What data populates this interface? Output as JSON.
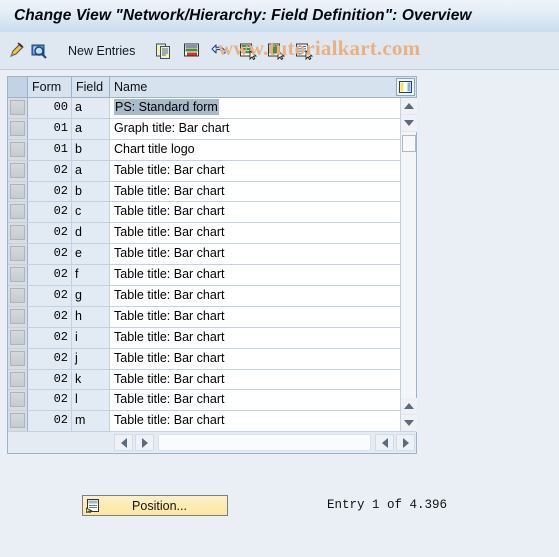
{
  "window": {
    "title": "Change View \"Network/Hierarchy: Field Definition\": Overview"
  },
  "watermark": {
    "text": "www.tutorialkart.com",
    "color": "#e8b183"
  },
  "toolbar": {
    "new_entries_label": "New Entries",
    "icons": [
      {
        "name": "change-pencil-icon",
        "title": "Change"
      },
      {
        "name": "display-magnifier-icon",
        "title": "Display"
      },
      {
        "name": "copy-icon",
        "title": "Copy As..."
      },
      {
        "name": "delete-row-icon",
        "title": "Delete"
      },
      {
        "name": "undo-icon",
        "title": "Undo Change"
      },
      {
        "name": "select-all-icon",
        "title": "Select All"
      },
      {
        "name": "deselect-all-icon",
        "title": "Deselect All"
      },
      {
        "name": "select-block-icon",
        "title": "Select Block"
      }
    ]
  },
  "table": {
    "columns": [
      "Form",
      "Field",
      "Name"
    ],
    "config_icon": "table-settings-icon",
    "selected_row_index": 0,
    "rows": [
      {
        "form": "00",
        "field": "a",
        "name": "PS: Standard form"
      },
      {
        "form": "01",
        "field": "a",
        "name": "Graph title: Bar chart"
      },
      {
        "form": "01",
        "field": "b",
        "name": "Chart title logo"
      },
      {
        "form": "02",
        "field": "a",
        "name": "Table title: Bar chart"
      },
      {
        "form": "02",
        "field": "b",
        "name": "Table title: Bar chart"
      },
      {
        "form": "02",
        "field": "c",
        "name": "Table title: Bar chart"
      },
      {
        "form": "02",
        "field": "d",
        "name": "Table title: Bar chart"
      },
      {
        "form": "02",
        "field": "e",
        "name": "Table title: Bar chart"
      },
      {
        "form": "02",
        "field": "f",
        "name": "Table title: Bar chart"
      },
      {
        "form": "02",
        "field": "g",
        "name": "Table title: Bar chart"
      },
      {
        "form": "02",
        "field": "h",
        "name": "Table title: Bar chart"
      },
      {
        "form": "02",
        "field": "i",
        "name": "Table title: Bar chart"
      },
      {
        "form": "02",
        "field": "j",
        "name": "Table title: Bar chart"
      },
      {
        "form": "02",
        "field": "k",
        "name": "Table title: Bar chart"
      },
      {
        "form": "02",
        "field": "l",
        "name": "Table title: Bar chart"
      },
      {
        "form": "02",
        "field": "m",
        "name": "Table title: Bar chart"
      }
    ]
  },
  "footer": {
    "position_button_label": "Position...",
    "entry_status": "Entry 1 of 4.396"
  },
  "colors": {
    "page_background": "#e9eff5",
    "title_bar": "#c9dcee",
    "toolbar": "#dfe8f1",
    "table_border": "#9ab3ca",
    "header_cell": "#d6e2ee",
    "key_cell": "#e2ebf3",
    "selection": "#a9bacd",
    "button_yellow": "#fbe89f"
  }
}
